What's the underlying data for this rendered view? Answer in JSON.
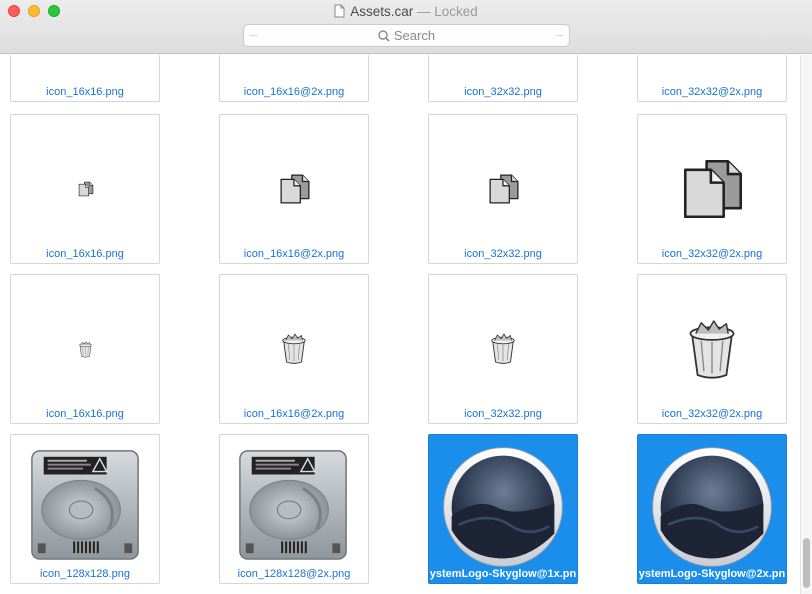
{
  "window": {
    "filename": "Assets.car",
    "status": "— Locked",
    "search_placeholder": "Search"
  },
  "grid": {
    "row0": [
      "icon_16x16.png",
      "icon_16x16@2x.png",
      "icon_32x32.png",
      "icon_32x32@2x.png"
    ],
    "row1": [
      "icon_16x16.png",
      "icon_16x16@2x.png",
      "icon_32x32.png",
      "icon_32x32@2x.png"
    ],
    "row2": [
      "icon_16x16.png",
      "icon_16x16@2x.png",
      "icon_32x32.png",
      "icon_32x32@2x.png"
    ],
    "row3": [
      "icon_128x128.png",
      "icon_128x128@2x.png",
      "ystemLogo-Skyglow@1x.pn",
      "ystemLogo-Skyglow@2x.pn"
    ]
  },
  "colors": {
    "selection": "#1a8eea",
    "link_label": "#1b72d1"
  }
}
